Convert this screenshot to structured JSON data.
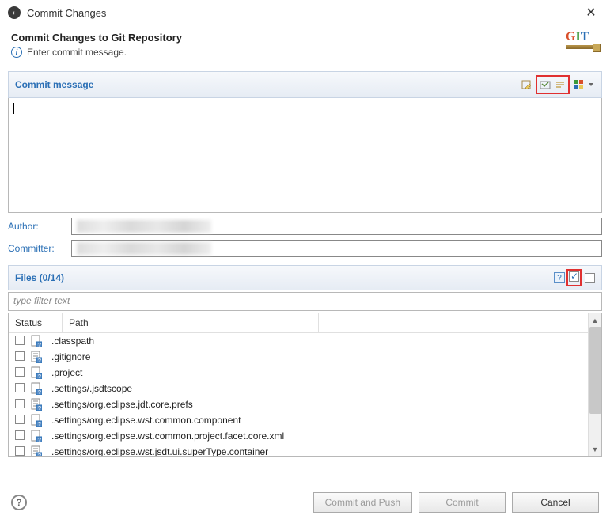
{
  "titlebar": {
    "title": "Commit Changes"
  },
  "header": {
    "title": "Commit Changes to Git Repository",
    "message": "Enter commit message."
  },
  "commit_section": {
    "title": "Commit message"
  },
  "author": {
    "label": "Author:"
  },
  "committer": {
    "label": "Committer:"
  },
  "files_section": {
    "title": "Files (0/14)"
  },
  "filter": {
    "placeholder": "type filter text"
  },
  "table": {
    "headers": {
      "status": "Status",
      "path": "Path"
    },
    "rows": [
      {
        "path": ".classpath",
        "icon": "file-mod"
      },
      {
        "path": ".gitignore",
        "icon": "file-txt"
      },
      {
        "path": ".project",
        "icon": "file-mod"
      },
      {
        "path": ".settings/.jsdtscope",
        "icon": "file-mod"
      },
      {
        "path": ".settings/org.eclipse.jdt.core.prefs",
        "icon": "file-txt"
      },
      {
        "path": ".settings/org.eclipse.wst.common.component",
        "icon": "file-mod"
      },
      {
        "path": ".settings/org.eclipse.wst.common.project.facet.core.xml",
        "icon": "file-mod"
      },
      {
        "path": ".settings/org.eclipse.wst.jsdt.ui.superType.container",
        "icon": "file-txt"
      }
    ]
  },
  "buttons": {
    "commit_push": "Commit and Push",
    "commit": "Commit",
    "cancel": "Cancel"
  }
}
